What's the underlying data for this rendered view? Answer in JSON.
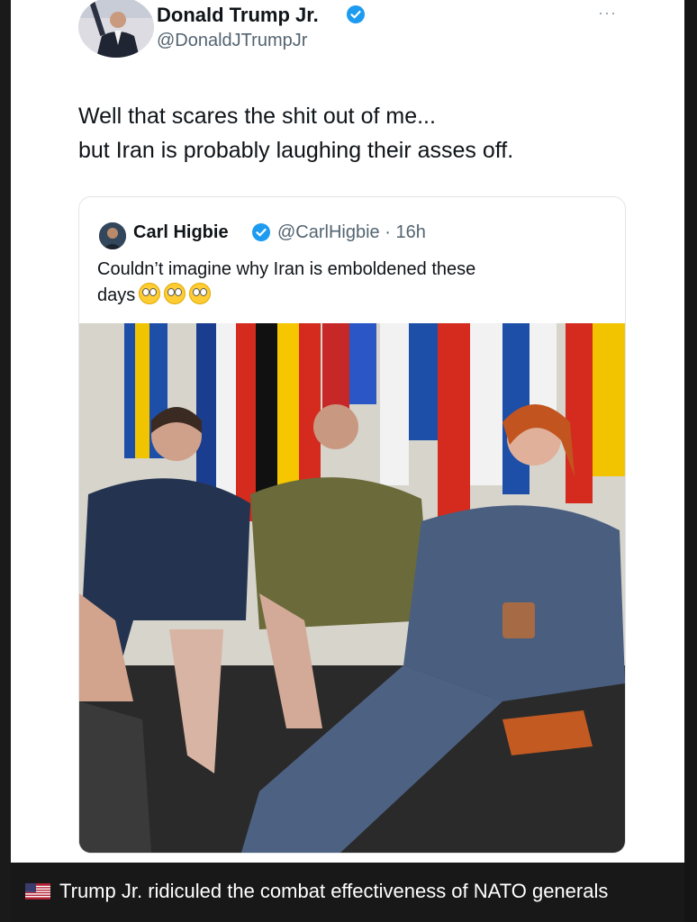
{
  "tweet": {
    "display_name": "Donald Trump Jr.",
    "handle": "@DonaldJTrumpJr",
    "text_lines": [
      "Well that scares the shit out of me...",
      "but Iran is probably laughing their asses off."
    ],
    "more_icon": "···"
  },
  "quoted_tweet": {
    "display_name": "Carl Higbie",
    "handle_time": "@CarlHigbie · 16h",
    "text_line1": "Couldn’t imagine why Iran is emboldened these",
    "text_line2": "days",
    "emoji": "rolling-eyes-face"
  },
  "caption": {
    "text": "Trump Jr. ridiculed the combat effectiveness of NATO generals",
    "flag_icon": "us-flag-icon"
  },
  "colors": {
    "verified": "#1d9bf0",
    "caption_bg": "#181818",
    "text": "#0f1419",
    "secondary_text": "#536471"
  }
}
